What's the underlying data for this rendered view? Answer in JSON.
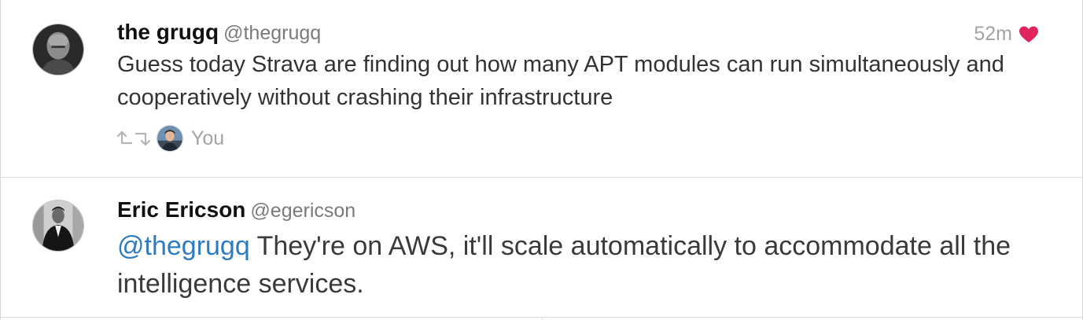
{
  "timeline": {
    "tweets": [
      {
        "author": {
          "display_name": "the grugq",
          "handle": "@thegrugq",
          "avatar_icon": "avatar-grugq"
        },
        "timestamp": "52m",
        "liked": true,
        "like_color": "#e0245e",
        "text": "Guess today Strava are finding out how many APT modules can run simultaneously and cooperatively without crashing their infrastructure",
        "social_context": {
          "icon": "retweet-icon",
          "label": "You"
        }
      },
      {
        "author": {
          "display_name": "Eric Ericson",
          "handle": "@egericson",
          "avatar_icon": "avatar-ericson"
        },
        "mention": "@thegrugq",
        "text": " They're on AWS, it'll scale automatically to accommodate all the intelligence services."
      }
    ]
  },
  "colors": {
    "mention": "#2f7bbf",
    "muted_text": "#a3a3a3",
    "divider": "#dcdcdc"
  }
}
